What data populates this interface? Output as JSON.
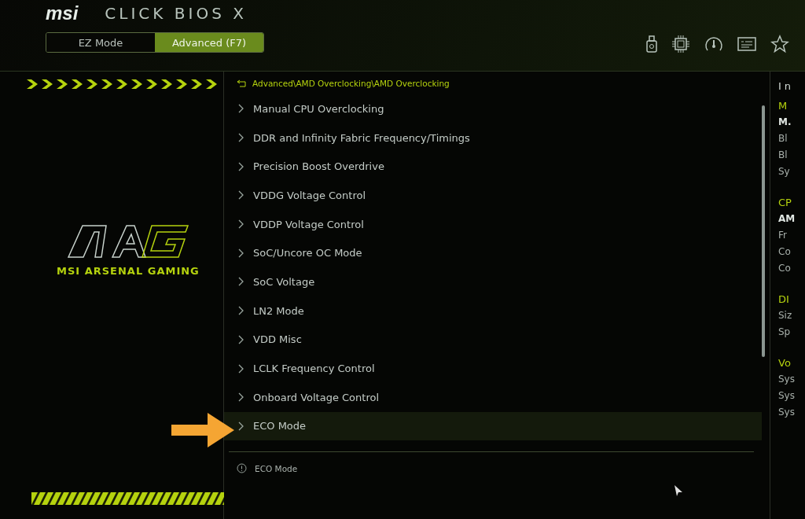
{
  "header": {
    "logo": "msi",
    "title": "CLICK BIOS X"
  },
  "mode_tabs": [
    {
      "label": "EZ Mode",
      "selected": false
    },
    {
      "label": "Advanced (F7)",
      "selected": true
    }
  ],
  "sidebar": {
    "brand_subtitle": "MSI ARSENAL GAMING"
  },
  "breadcrumb": "Advanced\\AMD Overclocking\\AMD Overclocking",
  "menu_items": [
    {
      "label": "Manual CPU Overclocking",
      "selected": false
    },
    {
      "label": "DDR and Infinity Fabric Frequency/Timings",
      "selected": false
    },
    {
      "label": "Precision Boost Overdrive",
      "selected": false
    },
    {
      "label": "VDDG Voltage Control",
      "selected": false
    },
    {
      "label": "VDDP Voltage Control",
      "selected": false
    },
    {
      "label": "SoC/Uncore OC Mode",
      "selected": false
    },
    {
      "label": "SoC Voltage",
      "selected": false
    },
    {
      "label": "LN2 Mode",
      "selected": false
    },
    {
      "label": "VDD Misc",
      "selected": false
    },
    {
      "label": "LCLK Frequency Control",
      "selected": false
    },
    {
      "label": "Onboard Voltage Control",
      "selected": false
    },
    {
      "label": "ECO Mode",
      "selected": true
    }
  ],
  "help_text": "ECO Mode",
  "info_panel": [
    {
      "text": "In",
      "kind": "title"
    },
    {
      "text": "M",
      "kind": "heading"
    },
    {
      "text": "M.",
      "kind": "bold"
    },
    {
      "text": "Bl",
      "kind": "text"
    },
    {
      "text": "Bl",
      "kind": "text"
    },
    {
      "text": "Sy",
      "kind": "text"
    },
    {
      "text": "CP",
      "kind": "heading"
    },
    {
      "text": "AM",
      "kind": "bold"
    },
    {
      "text": "Fr",
      "kind": "text"
    },
    {
      "text": "Co",
      "kind": "text"
    },
    {
      "text": "Co",
      "kind": "text"
    },
    {
      "text": "DI",
      "kind": "heading"
    },
    {
      "text": "Siz",
      "kind": "text"
    },
    {
      "text": "Sp",
      "kind": "text"
    },
    {
      "text": "Vo",
      "kind": "heading"
    },
    {
      "text": "Sys",
      "kind": "text"
    },
    {
      "text": "Sys",
      "kind": "text"
    },
    {
      "text": "Sys",
      "kind": "text"
    }
  ]
}
